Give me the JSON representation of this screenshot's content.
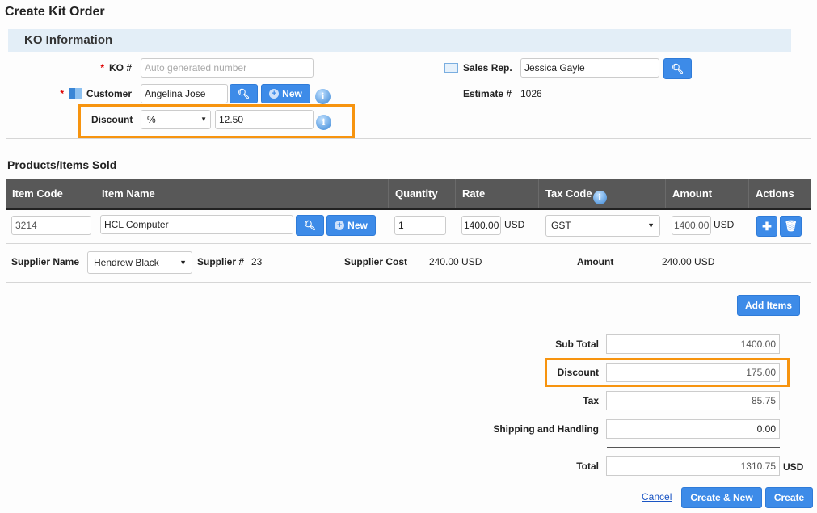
{
  "page_title": "Create Kit Order",
  "ko_section": {
    "title": "KO Information",
    "ko_label": "KO #",
    "ko_placeholder": "Auto generated number",
    "customer_label": "Customer",
    "customer_value": "Angelina Jose",
    "new_label": "New",
    "discount_label": "Discount",
    "discount_type": "%",
    "discount_value": "12.50",
    "sales_rep_label": "Sales Rep.",
    "sales_rep_value": "Jessica Gayle",
    "estimate_label": "Estimate #",
    "estimate_value": "1026"
  },
  "products": {
    "title": "Products/Items Sold",
    "columns": [
      "Item Code",
      "Item Name",
      "Quantity",
      "Rate",
      "Tax Code",
      "Amount",
      "Actions"
    ],
    "row": {
      "item_code": "3214",
      "item_name": "HCL Computer",
      "new_label": "New",
      "quantity": "1",
      "rate": "1400.00",
      "rate_currency": "USD",
      "tax_code": "GST",
      "amount": "1400.00",
      "amount_currency": "USD"
    },
    "supplier": {
      "name_label": "Supplier Name",
      "name_value": "Hendrew Black",
      "number_label": "Supplier #",
      "number_value": "23",
      "cost_label": "Supplier Cost",
      "cost_value": "240.00",
      "cost_currency": "USD",
      "amount_label": "Amount",
      "amount_value": "240.00",
      "amount_currency": "USD"
    },
    "add_items": "Add Items"
  },
  "totals": {
    "sub_total_label": "Sub Total",
    "sub_total": "1400.00",
    "discount_label": "Discount",
    "discount": "175.00",
    "tax_label": "Tax",
    "tax": "85.75",
    "shipping_label": "Shipping and Handling",
    "shipping": "0.00",
    "total_label": "Total",
    "total": "1310.75",
    "currency": "USD"
  },
  "footer": {
    "cancel": "Cancel",
    "create_new": "Create & New",
    "create": "Create"
  },
  "colors": {
    "accent": "#3d8be8",
    "highlight": "#f7940f",
    "header": "#585858",
    "section": "#e3eef7"
  }
}
